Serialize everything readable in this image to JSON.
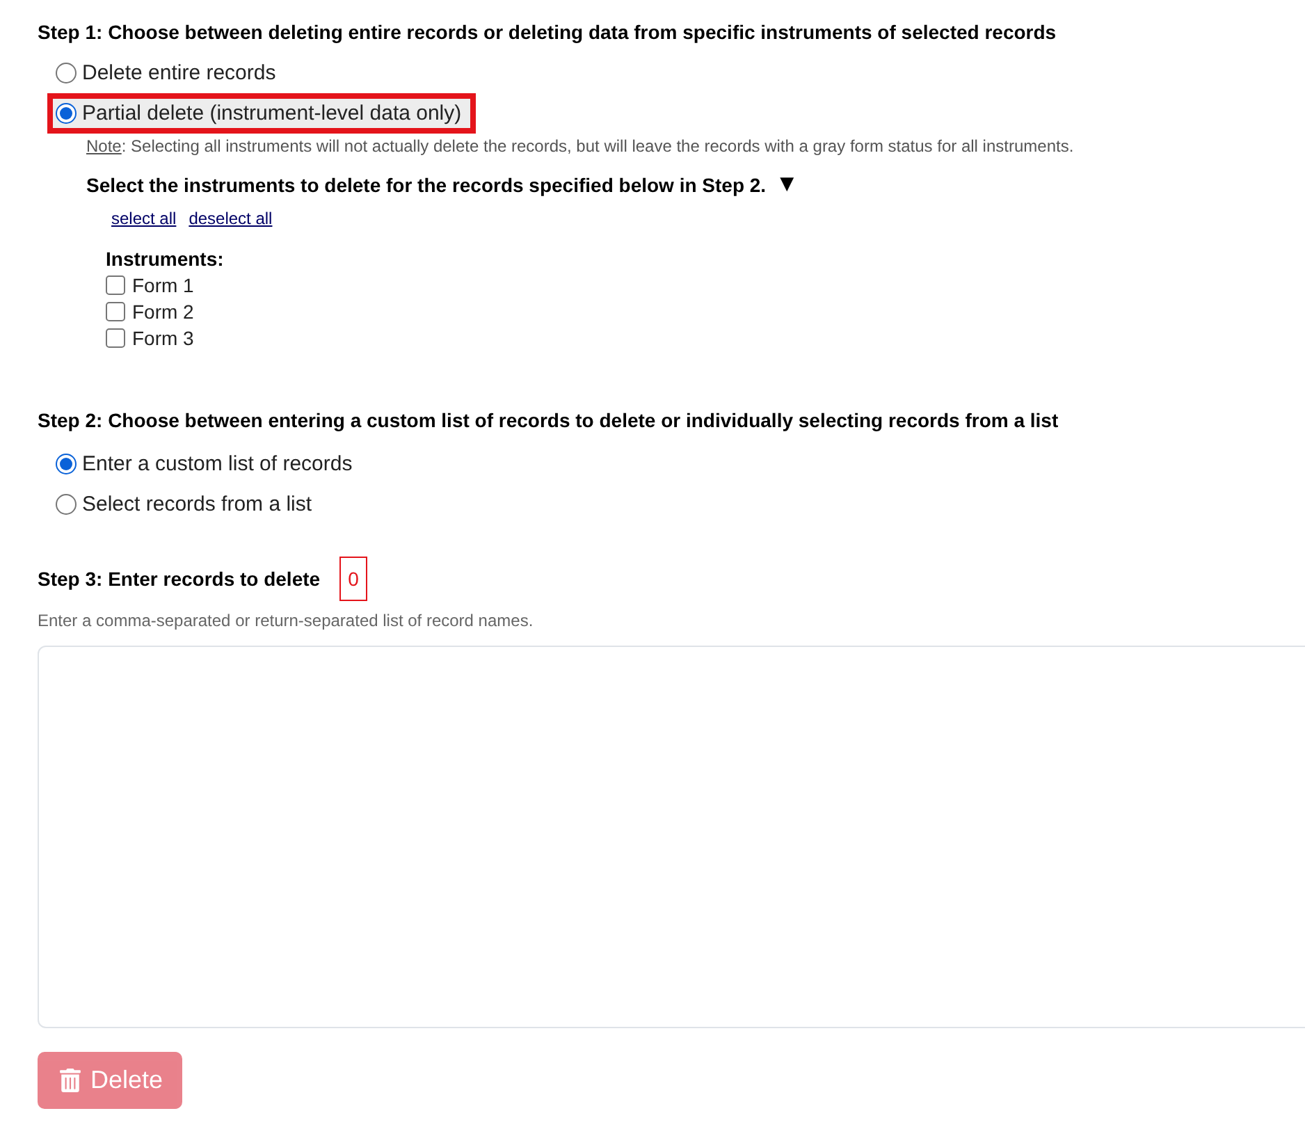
{
  "step1": {
    "heading": "Step 1: Choose between deleting entire records or deleting data from specific instruments of selected records",
    "options": [
      {
        "label": "Delete entire records",
        "selected": false,
        "highlighted": false
      },
      {
        "label": "Partial delete (instrument-level data only)",
        "selected": true,
        "highlighted": true
      }
    ],
    "note": {
      "label": "Note",
      "text": ": Selecting all instruments will not actually delete the records, but will leave the records with a gray form status for all instruments."
    },
    "instruments_heading": "Select the instruments to delete for the records specified below in Step 2.",
    "toggle": "▼",
    "links": [
      "select all",
      "deselect all"
    ],
    "instruments_label": "Instruments:",
    "instruments": [
      {
        "label": "Form 1",
        "checked": false
      },
      {
        "label": "Form 2",
        "checked": false
      },
      {
        "label": "Form 3",
        "checked": false
      }
    ]
  },
  "step2": {
    "heading": "Step 2: Choose between entering a custom list of records to delete or individually selecting records from a list",
    "options": [
      {
        "label": "Enter a custom list of records",
        "selected": true,
        "highlighted": false
      },
      {
        "label": "Select records from a list",
        "selected": false,
        "highlighted": false
      }
    ]
  },
  "step3": {
    "heading": "Step 3: Enter records to delete",
    "count": "0",
    "hint": "Enter a comma-separated or return-separated list of record names."
  },
  "delete_button": {
    "label": "Delete",
    "disabled": true
  }
}
